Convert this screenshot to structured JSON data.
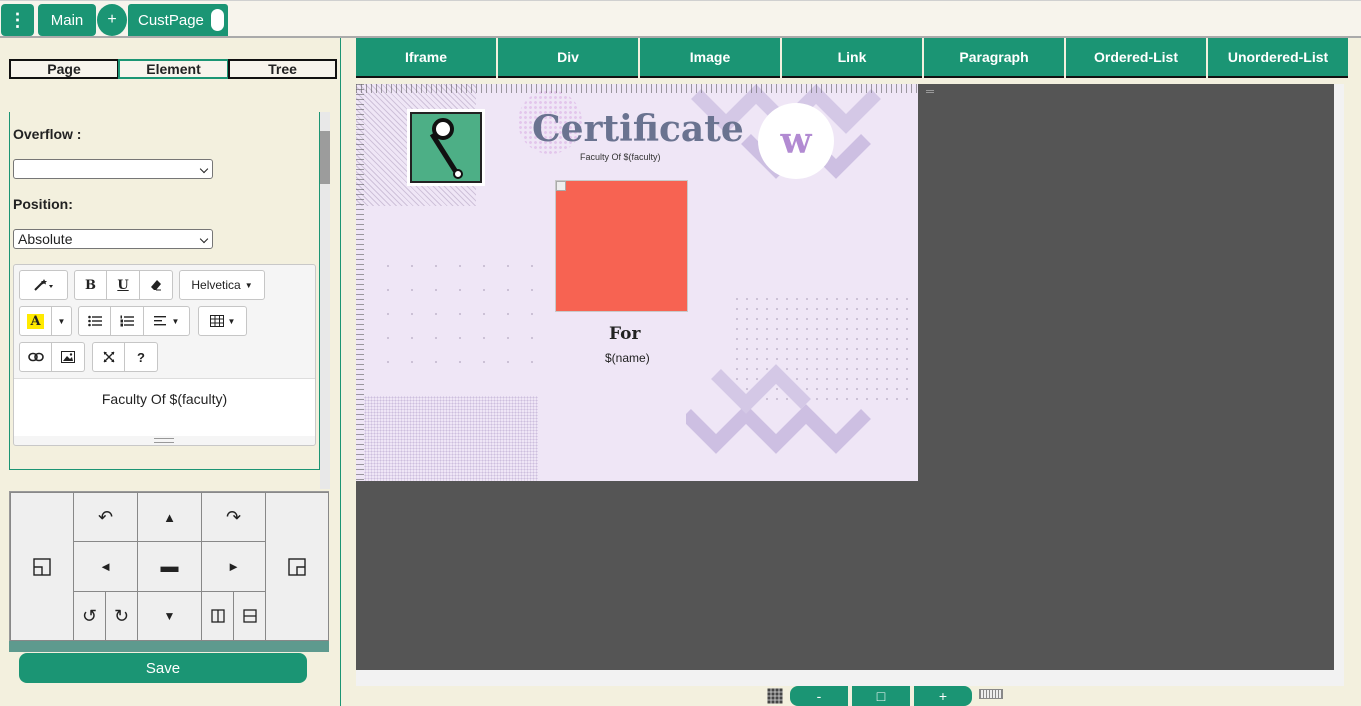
{
  "topbar": {
    "menu_glyph": "⋮",
    "main_tab": "Main",
    "add_tab": "+",
    "custom_tab": "CustPage"
  },
  "sidebar": {
    "tabs": [
      {
        "label": "Page",
        "active": false
      },
      {
        "label": "Element",
        "active": true
      },
      {
        "label": "Tree",
        "active": false
      }
    ],
    "overflow_label": "Overflow :",
    "overflow_value": "",
    "position_label": "Position:",
    "position_value": "Absolute"
  },
  "editor": {
    "bold": "B",
    "underline": "U",
    "font": "Helvetica",
    "highlight": "A",
    "help": "?",
    "content": "Faculty Of $(faculty)"
  },
  "control_pad": {
    "undo": "↶",
    "up": "▲",
    "redo": "↷",
    "left": "◄",
    "center": "▬",
    "right": "►",
    "rotate_left": "↺",
    "rotate_right": "↻",
    "down": "▼"
  },
  "save_label": "Save",
  "element_toolbar": [
    "Iframe",
    "Div",
    "Image",
    "Link",
    "Paragraph",
    "Ordered-List",
    "Unordered-List"
  ],
  "certificate": {
    "title": "Certificate",
    "subtitle": "Faculty Of $(faculty)",
    "logo_letter": "w",
    "for_label": "For",
    "name_placeholder": "$(name)"
  },
  "zoom": {
    "minus": "-",
    "reset": "□",
    "plus": "+"
  },
  "colors": {
    "accent": "#1b9574",
    "photo_placeholder": "#f76352",
    "certificate_bg": "#efe6f6",
    "workspace_bg": "#555555"
  }
}
